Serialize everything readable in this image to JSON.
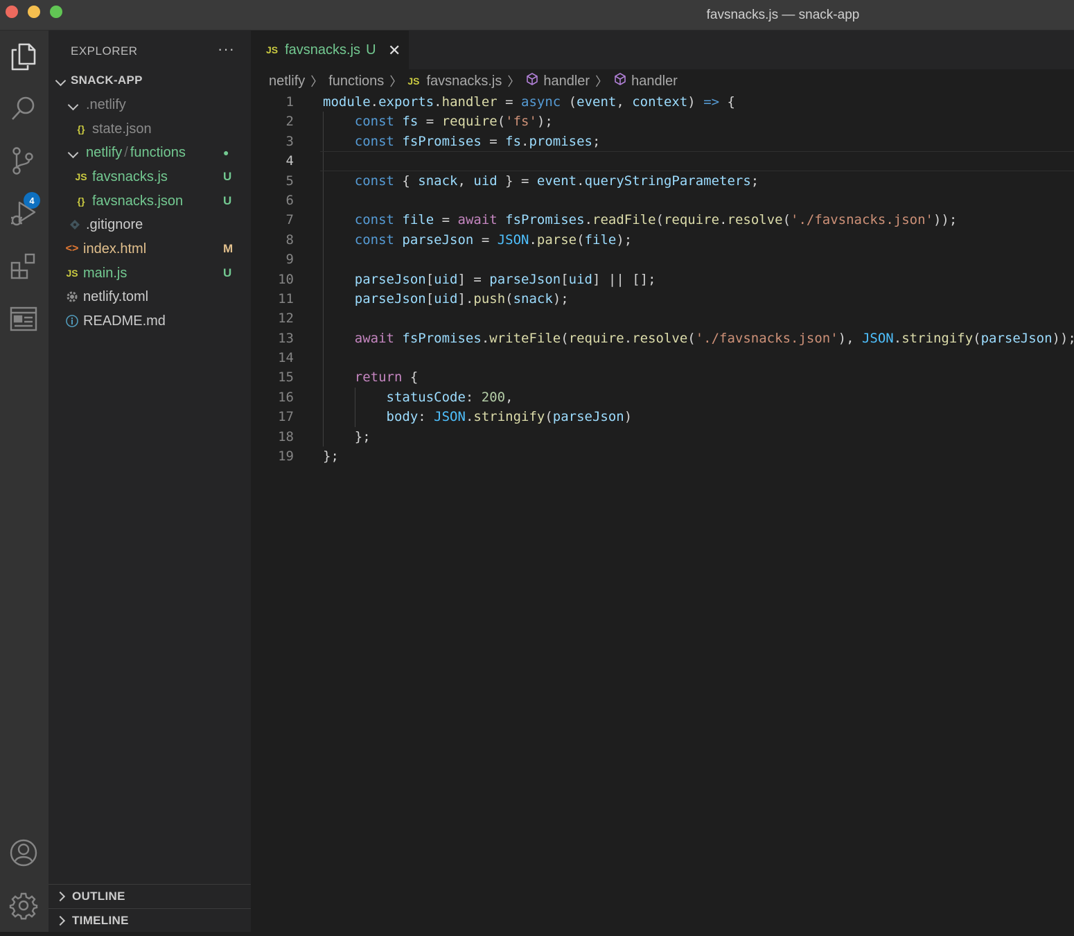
{
  "window": {
    "title": "favsnacks.js — snack-app"
  },
  "activity_bar": {
    "items": [
      {
        "icon": "files-icon"
      },
      {
        "icon": "search-icon"
      },
      {
        "icon": "source-control-icon",
        "badge": "4"
      },
      {
        "icon": "run-debug-icon"
      },
      {
        "icon": "extensions-icon"
      },
      {
        "icon": "remote-explorer-icon"
      }
    ],
    "bottom": [
      {
        "icon": "account-icon"
      },
      {
        "icon": "gear-icon"
      }
    ]
  },
  "sidebar": {
    "header": "EXPLORER",
    "more": "···",
    "root": "SNACK-APP",
    "tree": [
      {
        "name": ".netlify",
        "status": ""
      },
      {
        "name": "state.json",
        "status": ""
      },
      {
        "name_a": "netlify",
        "name_sep": "/",
        "name_b": "functions",
        "status": "●"
      },
      {
        "name": "favsnacks.js",
        "status": "U"
      },
      {
        "name": "favsnacks.json",
        "status": "U"
      },
      {
        "name": ".gitignore",
        "status": ""
      },
      {
        "name": "index.html",
        "status": "M"
      },
      {
        "name": "main.js",
        "status": "U"
      },
      {
        "name": "netlify.toml",
        "status": ""
      },
      {
        "name": "README.md",
        "status": ""
      }
    ],
    "icons": {
      "js": "JS",
      "json": "{}",
      "html": "<>"
    },
    "sections": [
      "OUTLINE",
      "TIMELINE"
    ]
  },
  "editor": {
    "tab": {
      "label": "favsnacks.js",
      "status": "U",
      "icon": "JS",
      "close": "✕"
    },
    "breadcrumb": [
      "netlify",
      "functions",
      "favsnacks.js",
      "handler",
      "handler"
    ],
    "active_line": 4,
    "line_numbers": [
      "1",
      "2",
      "3",
      "4",
      "5",
      "6",
      "7",
      "8",
      "9",
      "10",
      "11",
      "12",
      "13",
      "14",
      "15",
      "16",
      "17",
      "18",
      "19"
    ],
    "code_lines": [
      "module.exports.handler = async (event, context) => {",
      "    const fs = require('fs');",
      "    const fsPromises = fs.promises;",
      "",
      "    const { snack, uid } = event.queryStringParameters;",
      "",
      "    const file = await fsPromises.readFile(require.resolve('./favsnacks.json'));",
      "    const parseJson = JSON.parse(file);",
      "",
      "    parseJson[uid] = parseJson[uid] || [];",
      "    parseJson[uid].push(snack);",
      "",
      "    await fsPromises.writeFile(require.resolve('./favsnacks.json'), JSON.stringify(parseJson));",
      "",
      "    return {",
      "        statusCode: 200,",
      "        body: JSON.stringify(parseJson)",
      "    };",
      "};"
    ]
  },
  "colors": {
    "accent": "#007acc",
    "untracked": "#73c991",
    "modified": "#e2c08d",
    "badge": "#0e70c0"
  }
}
